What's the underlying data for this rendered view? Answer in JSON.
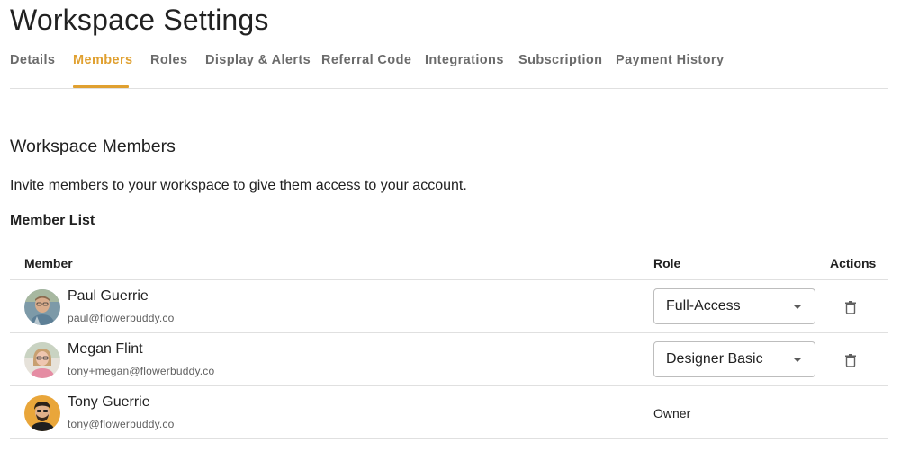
{
  "page": {
    "title": "Workspace Settings"
  },
  "tabs": [
    {
      "label": "Details",
      "active": false
    },
    {
      "label": "Members",
      "active": true
    },
    {
      "label": "Roles",
      "active": false
    },
    {
      "label": "Display & Alerts",
      "active": false
    },
    {
      "label": "Referral Code",
      "active": false
    },
    {
      "label": "Integrations",
      "active": false
    },
    {
      "label": "Subscription",
      "active": false
    },
    {
      "label": "Payment History",
      "active": false
    }
  ],
  "section": {
    "title": "Workspace Members",
    "description": "Invite members to your workspace to give them access to your account.",
    "list_title": "Member List"
  },
  "table": {
    "headers": {
      "member": "Member",
      "role": "Role",
      "actions": "Actions"
    },
    "rows": [
      {
        "name": "Paul Guerrie",
        "email": "paul@flowerbuddy.co",
        "role": "Full-Access",
        "role_editable": true,
        "deletable": true
      },
      {
        "name": "Megan Flint",
        "email": "tony+megan@flowerbuddy.co",
        "role": "Designer Basic",
        "role_editable": true,
        "deletable": true
      },
      {
        "name": "Tony Guerrie",
        "email": "tony@flowerbuddy.co",
        "role": "Owner",
        "role_editable": false,
        "deletable": false
      }
    ]
  },
  "icons": {
    "delete": "trash-icon",
    "dropdown": "caret-down-icon"
  },
  "colors": {
    "accent": "#e0a030",
    "divider": "#e0e0e0",
    "tab_inactive": "#6b6b6b"
  }
}
